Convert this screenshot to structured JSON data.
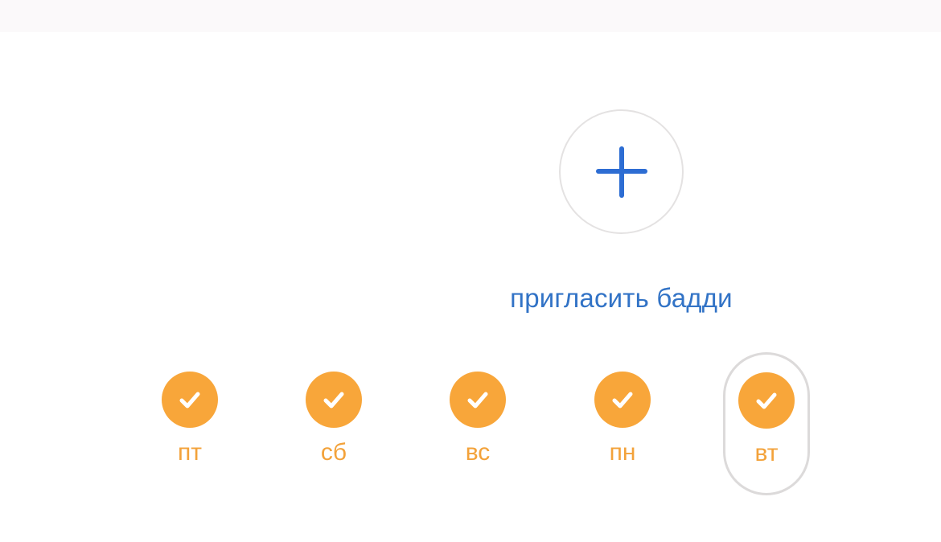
{
  "invite": {
    "label": "пригласить бадди",
    "icon": "plus-icon"
  },
  "days": [
    {
      "label": "пт",
      "checked": true,
      "selected": false
    },
    {
      "label": "сб",
      "checked": true,
      "selected": false
    },
    {
      "label": "вс",
      "checked": true,
      "selected": false
    },
    {
      "label": "пн",
      "checked": true,
      "selected": false
    },
    {
      "label": "вт",
      "checked": true,
      "selected": true
    }
  ],
  "colors": {
    "accent_blue": "#2d6dd3",
    "check_orange": "#f8a63a",
    "day_label_orange": "#f3a23a"
  }
}
